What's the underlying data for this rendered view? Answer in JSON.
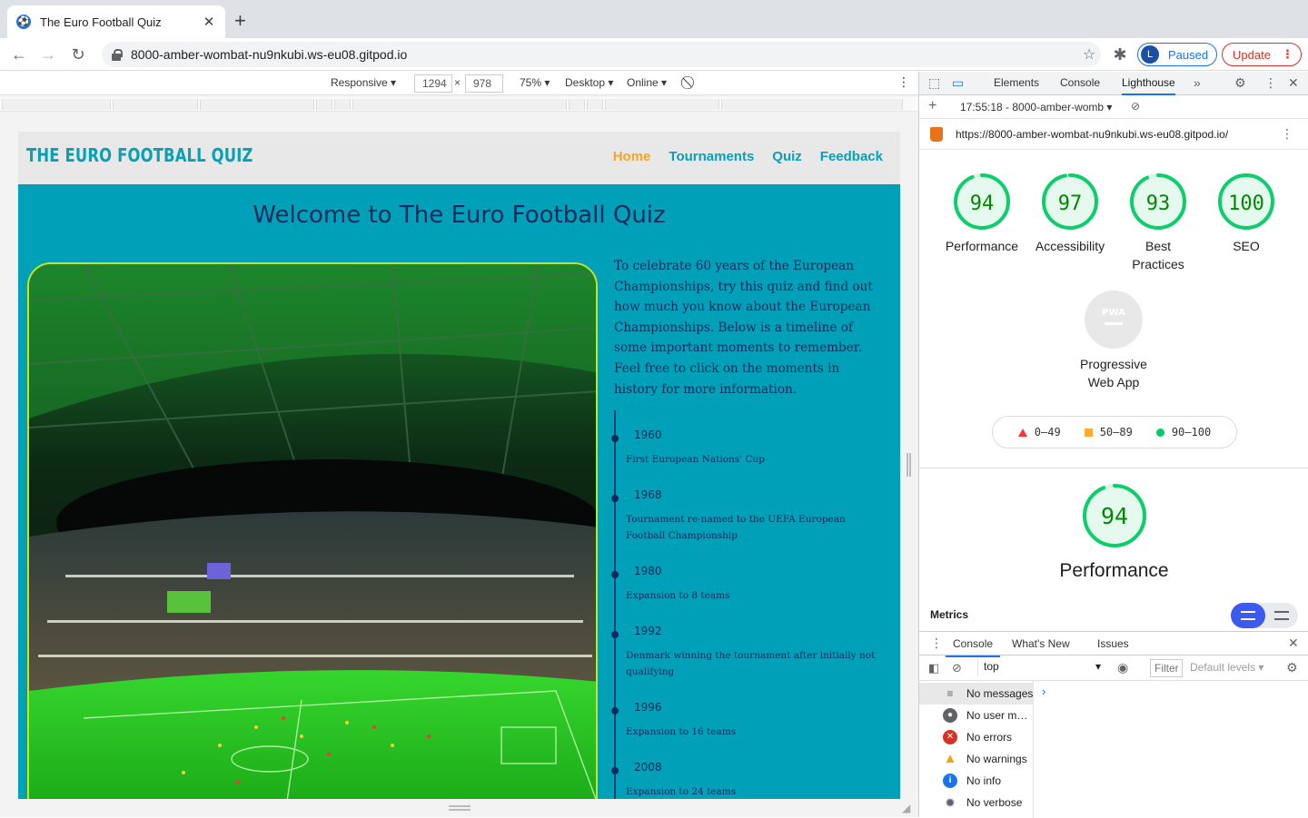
{
  "browser": {
    "tab_title": "The Euro Football Quiz",
    "url": "8000-amber-wombat-nu9nkubi.ws-eu08.gitpod.io",
    "profile_initial": "L",
    "profile_status": "Paused",
    "update_label": "Update"
  },
  "device_toolbar": {
    "mode": "Responsive",
    "width": "1294",
    "height": "978",
    "zoom": "75%",
    "device_type": "Desktop",
    "throttle": "Online"
  },
  "site": {
    "logo": "THE EURO FOOTBALL QUIZ",
    "nav": [
      "Home",
      "Tournaments",
      "Quiz",
      "Feedback"
    ],
    "heading": "Welcome to The Euro Football Quiz",
    "intro": "To celebrate 60 years of the European Championships, try this quiz and find out how much you know about the European Championships. Below is a timeline of some important moments to remember. Feel free to click on the moments in history for more information.",
    "timeline": [
      {
        "year": "1960",
        "desc": "First European Nations' Cup"
      },
      {
        "year": "1968",
        "desc": "Tournament re-named to the UEFA European Football Championship"
      },
      {
        "year": "1980",
        "desc": "Expansion to 8 teams"
      },
      {
        "year": "1992",
        "desc": "Denmark winning the tournament after initially not qualifying"
      },
      {
        "year": "1996",
        "desc": "Expansion to 16 teams"
      },
      {
        "year": "2008",
        "desc": "Expansion to 24 teams"
      }
    ]
  },
  "devtools": {
    "tabs": [
      "Elements",
      "Console",
      "Lighthouse"
    ],
    "report_time": "17:55:18 - 8000-amber-womb",
    "report_url": "https://8000-amber-wombat-nu9nkubi.ws-eu08.gitpod.io/",
    "scores": [
      {
        "value": "94",
        "label": "Performance",
        "score": 94
      },
      {
        "value": "97",
        "label": "Accessibility",
        "score": 97
      },
      {
        "value": "93",
        "label": "Best Practices",
        "score": 93
      },
      {
        "value": "100",
        "label": "SEO",
        "score": 100
      }
    ],
    "pwa_badge": "PWA",
    "pwa_label": "Progressive Web App",
    "legend": [
      "0–49",
      "50–89",
      "90–100"
    ],
    "perf_score": "94",
    "perf_label": "Performance",
    "metrics_label": "Metrics",
    "drawer_tabs": [
      "Console",
      "What's New",
      "Issues"
    ],
    "context": "top",
    "filter_placeholder": "Filter",
    "levels": "Default levels",
    "sidebar": [
      "No messages",
      "No user me…",
      "No errors",
      "No warnings",
      "No info",
      "No verbose"
    ],
    "colors": {
      "pass": "#0cce6b",
      "pass_text": "#008800",
      "accent": "#1a73e8"
    }
  }
}
